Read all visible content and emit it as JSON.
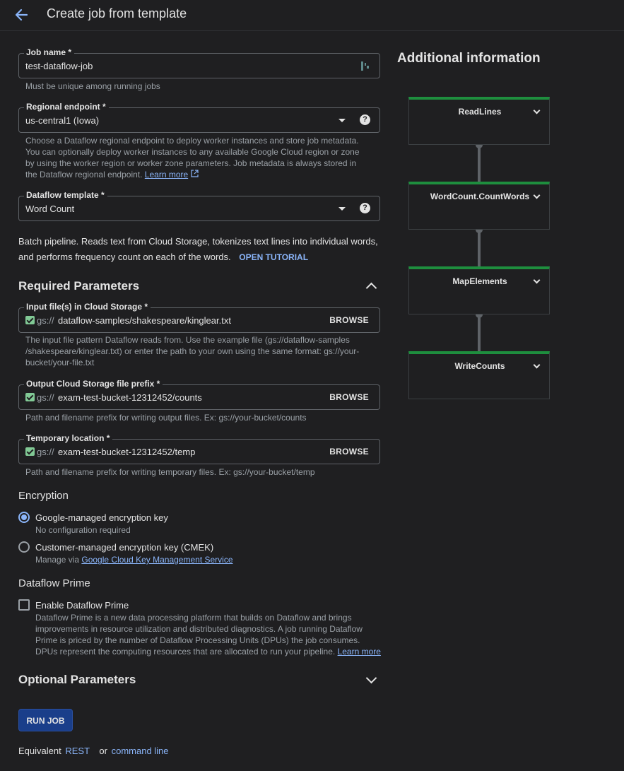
{
  "header": {
    "title": "Create job from template"
  },
  "job_name": {
    "label": "Job name *",
    "value": "test-dataflow-job",
    "helper": "Must be unique among running jobs"
  },
  "regional_endpoint": {
    "label": "Regional endpoint *",
    "value": "us-central1 (Iowa)",
    "helper_lines": [
      "Choose a Dataflow regional endpoint to deploy worker instances and store job metadata.",
      "You can optionally deploy worker instances to any available Google Cloud region or zone",
      "by using the worker region or worker zone parameters. Job metadata is always stored in",
      "the Dataflow regional endpoint."
    ],
    "learn_more": "Learn more"
  },
  "dataflow_template": {
    "label": "Dataflow template *",
    "value": "Word Count",
    "description_lines": [
      "Batch pipeline. Reads text from Cloud Storage, tokenizes text lines into individual words,",
      "and performs frequency count on each of the words."
    ],
    "tutorial": "OPEN TUTORIAL"
  },
  "required": {
    "title": "Required Parameters",
    "gs_prefix": "gs://",
    "browse": "BROWSE",
    "input": {
      "label": "Input file(s) in Cloud Storage *",
      "value": "dataflow-samples/shakespeare/kinglear.txt",
      "helper_lines": [
        "The input file pattern Dataflow reads from. Use the example file (gs://dataflow-samples",
        "/shakespeare/kinglear.txt) or enter the path to your own using the same format: gs://your-",
        "bucket/your-file.txt"
      ]
    },
    "output": {
      "label": "Output Cloud Storage file prefix *",
      "value": "exam-test-bucket-12312452/counts",
      "helper": "Path and filename prefix for writing output files. Ex: gs://your-bucket/counts"
    },
    "temp": {
      "label": "Temporary location *",
      "value": "exam-test-bucket-12312452/temp",
      "helper": "Path and filename prefix for writing temporary files. Ex: gs://your-bucket/temp"
    }
  },
  "encryption": {
    "title": "Encryption",
    "google": {
      "label": "Google-managed encryption key",
      "desc": "No configuration required",
      "selected": true
    },
    "cmek": {
      "label": "Customer-managed encryption key (CMEK)",
      "desc_prefix": "Manage via ",
      "desc_link": "Google Cloud Key Management Service",
      "selected": false
    }
  },
  "prime": {
    "title": "Dataflow Prime",
    "checkbox_label": "Enable Dataflow Prime",
    "checked": false,
    "desc_lines": [
      "Dataflow Prime is a new data processing platform that builds on Dataflow and brings",
      "improvements in resource utilization and distributed diagnostics. A job running Dataflow",
      "Prime is priced by the number of Dataflow Processing Units (DPUs) the job consumes.",
      "DPUs represent the computing resources that are allocated to run your pipeline."
    ],
    "learn_more": "Learn more"
  },
  "optional": {
    "title": "Optional Parameters"
  },
  "run_button": "RUN JOB",
  "footer": {
    "prefix": "Equivalent",
    "rest": "REST",
    "or": "or",
    "command_line": "command line"
  },
  "info": {
    "title": "Additional information",
    "nodes": [
      "ReadLines",
      "WordCount.CountWords",
      "MapElements",
      "WriteCounts"
    ]
  },
  "colors": {
    "accent": "#8ab4f8",
    "primary_button": "#1a3e8a",
    "node_status": "#1e8e3e",
    "background": "#1f1f21"
  }
}
